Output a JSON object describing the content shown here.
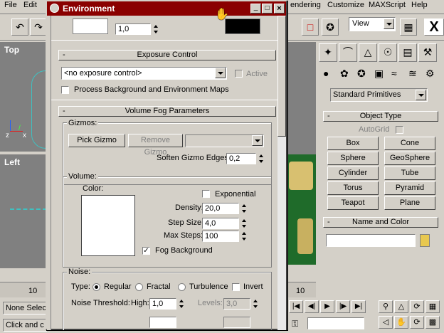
{
  "menu": {
    "file": "File",
    "edit": "Edit",
    "rendering": "endering",
    "customize": "Customize",
    "maxscript": "MAXScript",
    "help": "Help"
  },
  "toolbar": {
    "view_select": "View",
    "x_label": "X"
  },
  "viewports": {
    "top_label": "Top",
    "left_label": "Left",
    "axis_z": "z",
    "axis_x": "x",
    "ruler_value": "10"
  },
  "status": {
    "selection": "None Selec",
    "prompt": "Click and c"
  },
  "env_dialog": {
    "title": "Environment",
    "tint_value": "1,0",
    "exposure": {
      "header": "Exposure Control",
      "select_value": "<no exposure control>",
      "active_label": "Active",
      "process_label": "Process Background and Environment Maps"
    },
    "volume_fog": {
      "header": "Volume Fog Parameters",
      "gizmos_title": "Gizmos:",
      "pick_gizmo": "Pick Gizmo",
      "remove_gizmo": "Remove Gizmo",
      "soften_label": "Soften Gizmo Edges:",
      "soften_value": "0,2",
      "volume_title": "Volume:",
      "color_label": "Color:",
      "exponential_label": "Exponential",
      "density_label": "Density:",
      "density_value": "20,0",
      "step_size_label": "Step Size:",
      "step_size_value": "4,0",
      "max_steps_label": "Max Steps:",
      "max_steps_value": "100",
      "fog_bg_label": "Fog Background",
      "noise_title": "Noise:",
      "type_label": "Type:",
      "regular_label": "Regular",
      "fractal_label": "Fractal",
      "turbulence_label": "Turbulence",
      "invert_label": "Invert",
      "noise_threshold_label": "Noise Threshold:",
      "high_label": "High:",
      "high_value": "1,0",
      "levels_label": "Levels:",
      "levels_value": "3,0"
    }
  },
  "command_panel": {
    "category_select": "Standard Primitives",
    "object_type_header": "Object Type",
    "autogrid_label": "AutoGrid",
    "buttons": [
      "Box",
      "Cone",
      "Sphere",
      "GeoSphere",
      "Cylinder",
      "Tube",
      "Torus",
      "Pyramid",
      "Teapot",
      "Plane"
    ],
    "name_color_header": "Name and Color"
  },
  "colors": {
    "title_bar": "#8a0000",
    "viewport_bg": "#808080",
    "scene_green": "#1f6b2a",
    "object_color_swatch": "#e8c850"
  }
}
